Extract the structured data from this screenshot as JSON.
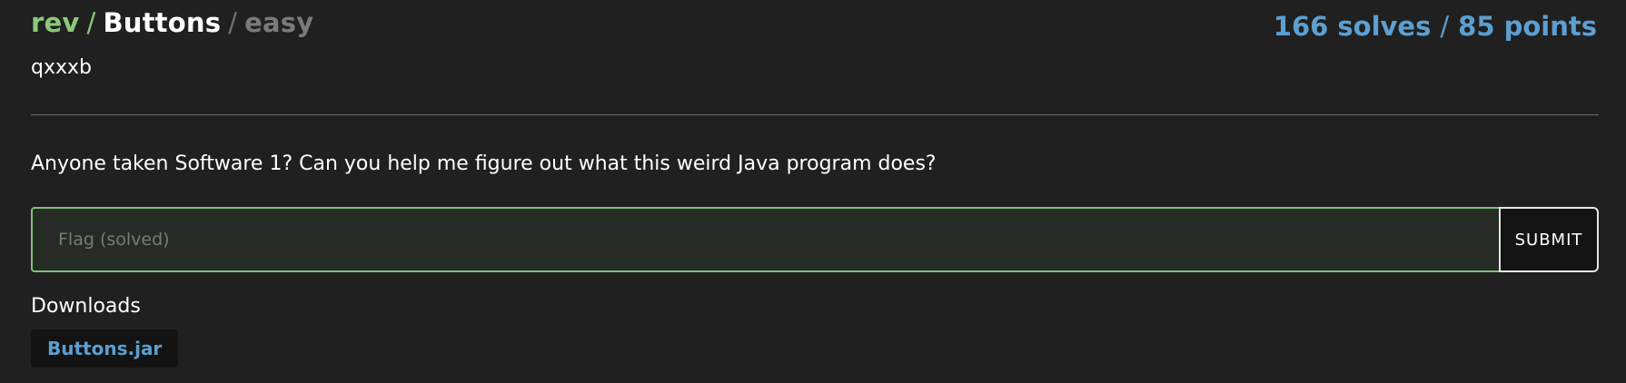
{
  "header": {
    "category": "rev",
    "separator": "/",
    "title": "Buttons",
    "difficulty": "easy",
    "solves": "166 solves",
    "points": "85 points"
  },
  "author": "qxxxb",
  "description": "Anyone taken Software 1? Can you help me figure out what this weird Java program does?",
  "flag_form": {
    "placeholder": "Flag (solved)",
    "value": "",
    "submit_label": "SUBMIT"
  },
  "downloads": {
    "label": "Downloads",
    "files": [
      {
        "name": "Buttons.jar"
      }
    ]
  },
  "colors": {
    "background": "#202020",
    "category_green": "#8cc97a",
    "accent_blue": "#5c9fd0",
    "input_border": "#7fc07a"
  }
}
